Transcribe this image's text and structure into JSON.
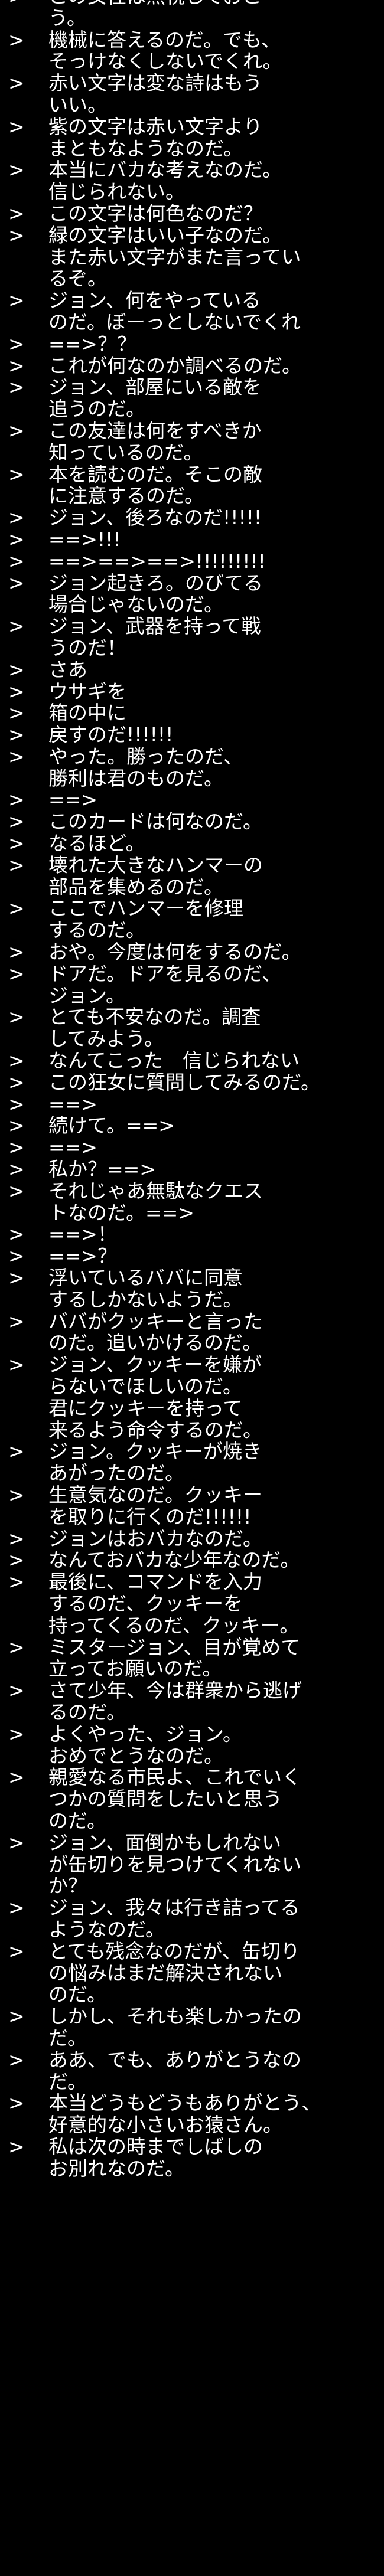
{
  "terminal": {
    "background": "#000000",
    "text_color": "#ffffff",
    "prompt_symbol": ">",
    "lines": [
      {
        "p": true,
        "t": "この女性は無視しておこ"
      },
      {
        "p": false,
        "t": "う。"
      },
      {
        "p": true,
        "t": "機械に答えるのだ。でも、"
      },
      {
        "p": false,
        "t": "そっけなくしないでくれ。"
      },
      {
        "p": true,
        "t": "赤い文字は変な詩はもう"
      },
      {
        "p": false,
        "t": "いい。"
      },
      {
        "p": true,
        "t": "紫の文字は赤い文字より"
      },
      {
        "p": false,
        "t": "まともなようなのだ。"
      },
      {
        "p": true,
        "t": "本当にバカな考えなのだ。"
      },
      {
        "p": false,
        "t": "信じられない。"
      },
      {
        "p": true,
        "t": "この文字は何色なのだ？"
      },
      {
        "p": true,
        "t": "緑の文字はいい子なのだ。"
      },
      {
        "p": false,
        "t": "また赤い文字がまた言ってい"
      },
      {
        "p": false,
        "t": "るぞ。"
      },
      {
        "p": true,
        "t": "ジョン、何をやっている"
      },
      {
        "p": false,
        "t": "のだ。ぼーっとしないでくれ"
      },
      {
        "p": true,
        "t": "==>？？"
      },
      {
        "p": true,
        "t": "これが何なのか調べるのだ。"
      },
      {
        "p": true,
        "t": "ジョン、部屋にいる敵を"
      },
      {
        "p": false,
        "t": "追うのだ。"
      },
      {
        "p": true,
        "t": "この友達は何をすべきか"
      },
      {
        "p": false,
        "t": "知っているのだ。"
      },
      {
        "p": true,
        "t": "本を読むのだ。そこの敵"
      },
      {
        "p": false,
        "t": "に注意するのだ。"
      },
      {
        "p": true,
        "t": "ジョン、後ろなのだ!!!!!"
      },
      {
        "p": true,
        "t": "==>!!!"
      },
      {
        "p": true,
        "t": "==>==>==>!!!!!!!!!"
      },
      {
        "p": true,
        "t": "ジョン起きろ。のびてる"
      },
      {
        "p": false,
        "t": "場合じゃないのだ。"
      },
      {
        "p": true,
        "t": "ジョン、武器を持って戦"
      },
      {
        "p": false,
        "t": "うのだ！"
      },
      {
        "p": true,
        "t": "さあ"
      },
      {
        "p": true,
        "t": "ウサギを"
      },
      {
        "p": true,
        "t": "箱の中に"
      },
      {
        "p": true,
        "t": "戻すのだ!!!!!!"
      },
      {
        "p": true,
        "t": "やった。勝ったのだ、"
      },
      {
        "p": false,
        "t": "勝利は君のものだ。"
      },
      {
        "p": true,
        "t": "==>"
      },
      {
        "p": true,
        "t": "このカードは何なのだ。"
      },
      {
        "p": true,
        "t": "なるほど。"
      },
      {
        "p": true,
        "t": "壊れた大きなハンマーの"
      },
      {
        "p": false,
        "t": "部品を集めるのだ。"
      },
      {
        "p": true,
        "t": "ここでハンマーを修理"
      },
      {
        "p": false,
        "t": "するのだ。"
      },
      {
        "p": true,
        "t": "おや。今度は何をするのだ。"
      },
      {
        "p": true,
        "t": "ドアだ。ドアを見るのだ、"
      },
      {
        "p": false,
        "t": "ジョン。"
      },
      {
        "p": true,
        "t": "とても不安なのだ。調査"
      },
      {
        "p": false,
        "t": "してみよう。"
      },
      {
        "p": true,
        "t": "なんてこった　信じられない"
      },
      {
        "p": true,
        "t": "この狂女に質問してみるのだ。"
      },
      {
        "p": true,
        "t": "==>"
      },
      {
        "p": true,
        "t": "続けて。==>"
      },
      {
        "p": true,
        "t": "==>"
      },
      {
        "p": true,
        "t": "私か？==>"
      },
      {
        "p": true,
        "t": "それじゃあ無駄なクエス"
      },
      {
        "p": false,
        "t": "トなのだ。==>"
      },
      {
        "p": true,
        "t": "==>！"
      },
      {
        "p": true,
        "t": "==>？"
      },
      {
        "p": true,
        "t": "浮いているババに同意"
      },
      {
        "p": false,
        "t": "するしかないようだ。"
      },
      {
        "p": true,
        "t": "ババがクッキーと言った"
      },
      {
        "p": false,
        "t": "のだ。追いかけるのだ。"
      },
      {
        "p": true,
        "t": "ジョン、クッキーを嫌が"
      },
      {
        "p": false,
        "t": "らないでほしいのだ。"
      },
      {
        "p": false,
        "t": "君にクッキーを持って"
      },
      {
        "p": false,
        "t": "来るよう命令するのだ。"
      },
      {
        "p": true,
        "t": "ジョン。クッキーが焼き"
      },
      {
        "p": false,
        "t": "あがったのだ。"
      },
      {
        "p": true,
        "t": "生意気なのだ。クッキー"
      },
      {
        "p": false,
        "t": "を取りに行くのだ!!!!!!"
      },
      {
        "p": true,
        "t": "ジョンはおバカなのだ。"
      },
      {
        "p": true,
        "t": "なんておバカな少年なのだ。"
      },
      {
        "p": true,
        "t": "最後に、コマンドを入力"
      },
      {
        "p": false,
        "t": "するのだ、クッキーを"
      },
      {
        "p": false,
        "t": "持ってくるのだ、クッキー。"
      },
      {
        "p": true,
        "t": "ミスタージョン、目が覚めて"
      },
      {
        "p": false,
        "t": "立ってお願いのだ。"
      },
      {
        "p": true,
        "t": "さて少年、今は群衆から逃げ"
      },
      {
        "p": false,
        "t": "るのだ。"
      },
      {
        "p": true,
        "t": "よくやった、ジョン。"
      },
      {
        "p": false,
        "t": "おめでとうなのだ。"
      },
      {
        "p": true,
        "t": "親愛なる市民よ、これでいく"
      },
      {
        "p": false,
        "t": "つかの質問をしたいと思う"
      },
      {
        "p": false,
        "t": "のだ。"
      },
      {
        "p": true,
        "t": "ジョン、面倒かもしれない"
      },
      {
        "p": false,
        "t": "が缶切りを見つけてくれない"
      },
      {
        "p": false,
        "t": "か？"
      },
      {
        "p": true,
        "t": "ジョン、我々は行き詰ってる"
      },
      {
        "p": false,
        "t": "ようなのだ。"
      },
      {
        "p": true,
        "t": "とても残念なのだが、缶切り"
      },
      {
        "p": false,
        "t": "の悩みはまだ解決されない"
      },
      {
        "p": false,
        "t": "のだ。"
      },
      {
        "p": true,
        "t": "しかし、それも楽しかったの"
      },
      {
        "p": false,
        "t": "だ。"
      },
      {
        "p": true,
        "t": "ああ、でも、ありがとうなの"
      },
      {
        "p": false,
        "t": "だ。"
      },
      {
        "p": true,
        "t": "本当どうもどうもありがとう、"
      },
      {
        "p": false,
        "t": "好意的な小さいお猿さん。"
      },
      {
        "p": true,
        "t": "私は次の時までしばしの"
      },
      {
        "p": false,
        "t": "お別れなのだ。"
      }
    ]
  }
}
